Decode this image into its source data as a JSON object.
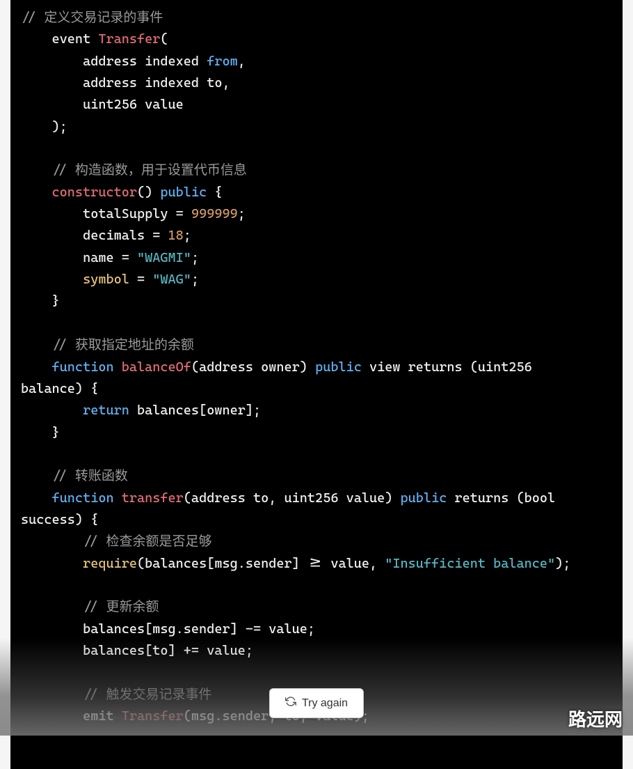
{
  "code": {
    "line1_comment": "// 定义交易记录的事件",
    "line2_event": "event",
    "line2_transfer": "Transfer",
    "line2_paren": "(",
    "line3_addr_indexed": "address indexed",
    "line3_from": "from",
    "line3_comma": ",",
    "line4_addr_indexed": "address indexed",
    "line4_to": "to",
    "line4_comma": ",",
    "line5_uint_value": "uint256 value",
    "line6_close": ");",
    "line8_comment": "// 构造函数，用于设置代币信息",
    "line9_constructor": "constructor",
    "line9_parens": "()",
    "line9_public": "public",
    "line9_brace": " {",
    "line10_ts": "totalSupply",
    "line10_eq": " = ",
    "line10_num": "999999",
    "line10_semi": ";",
    "line11_dec": "decimals",
    "line11_eq": " = ",
    "line11_num": "18",
    "line11_semi": ";",
    "line12_name": "name",
    "line12_eq": " = ",
    "line12_str": "\"WAGMI\"",
    "line12_semi": ";",
    "line13_symbol": "symbol",
    "line13_eq": " = ",
    "line13_str": "\"WAG\"",
    "line13_semi": ";",
    "line14_close": "}",
    "line16_comment": "// 获取指定地址的余额",
    "line17_function": "function",
    "line17_balanceOf": "balanceOf",
    "line17_params": "(address owner)",
    "line17_public": "public",
    "line17_rest": " view returns (uint256 ",
    "line17b_rest": "balance) {",
    "line18_return": "return",
    "line18_rest": " balances[owner];",
    "line19_close": "}",
    "line21_comment": "// 转账函数",
    "line22_function": "function",
    "line22_transfer": "transfer",
    "line22_params": "(address to, uint256 value)",
    "line22_public": "public",
    "line22_rest": " returns (bool ",
    "line22b_rest": "success) {",
    "line23_comment": "// 检查余额是否足够",
    "line24_require": "require",
    "line24_mid": "(balances[msg.sender] >= value, ",
    "line24_str": "\"Insufficient balance\"",
    "line24_end": ");",
    "line26_comment": "// 更新余额",
    "line27": "balances[msg.sender] -= value;",
    "line28": "balances[to] += value;",
    "line30_comment": "// 触发交易记录事件",
    "line31_emit": "emit",
    "line31_transfer": "Transfer",
    "line31_rest": "(msg.sender, to, value);"
  },
  "button": {
    "try_again": "Try again"
  },
  "watermark": "路远网"
}
